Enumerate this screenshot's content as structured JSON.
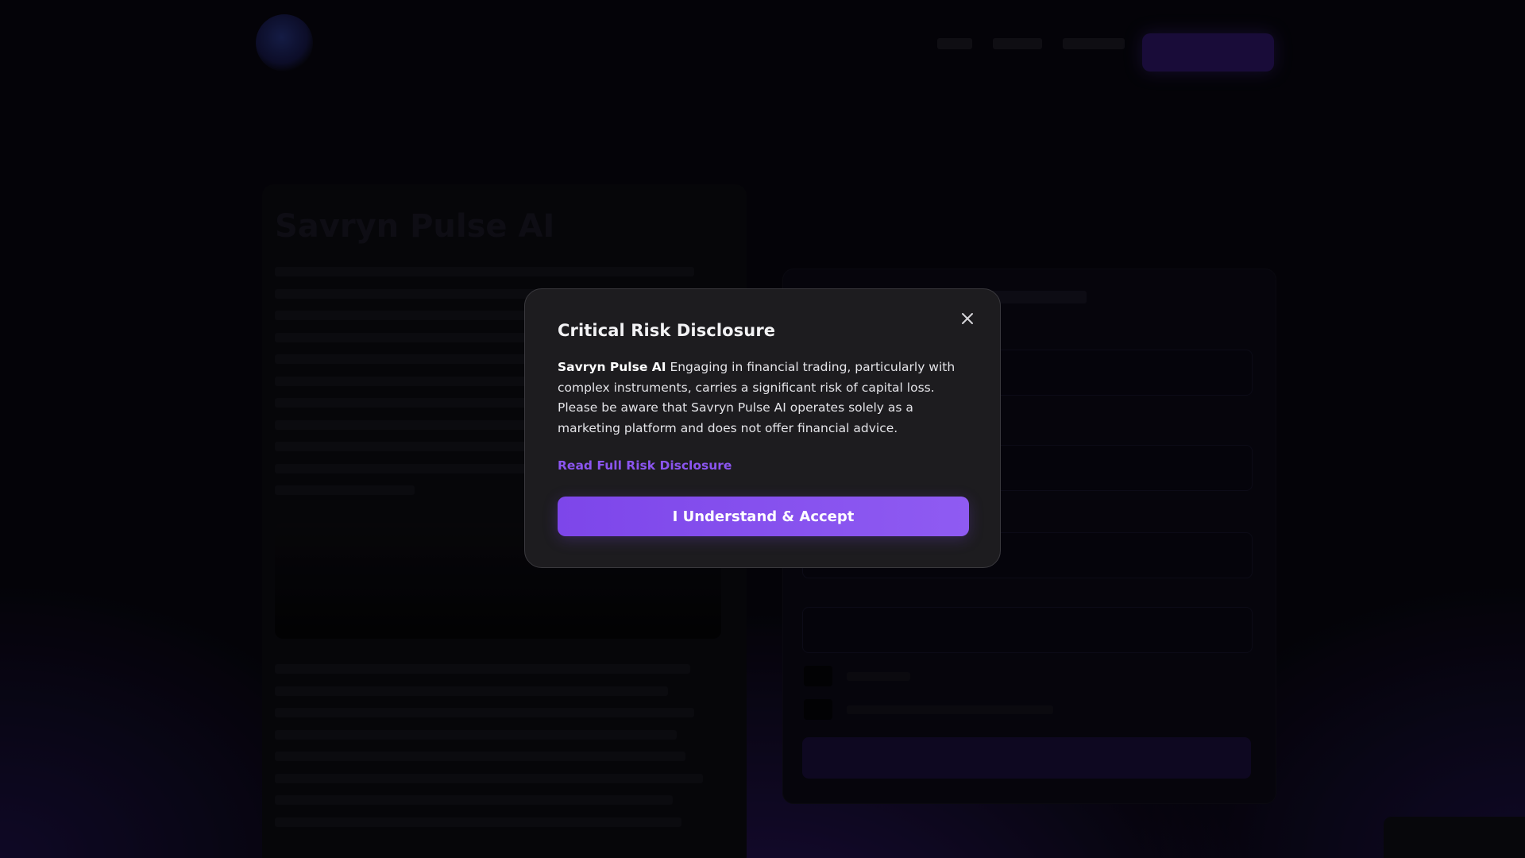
{
  "background": {
    "page_title": "Savryn Pulse AI"
  },
  "modal": {
    "title": "Critical Risk Disclosure",
    "brand": "Savryn Pulse AI",
    "body": " Engaging in financial trading, particularly with complex instruments, carries a significant risk of capital loss. Please be aware that Savryn Pulse AI operates solely as a marketing platform and does not offer financial advice.",
    "link_label": "Read Full Risk Disclosure",
    "accept_label": "I Understand & Accept",
    "close_icon": "close-icon"
  },
  "colors": {
    "accent": "#8b55f0",
    "button": "#7d46ea",
    "modal_bg": "#1d1c1f"
  }
}
